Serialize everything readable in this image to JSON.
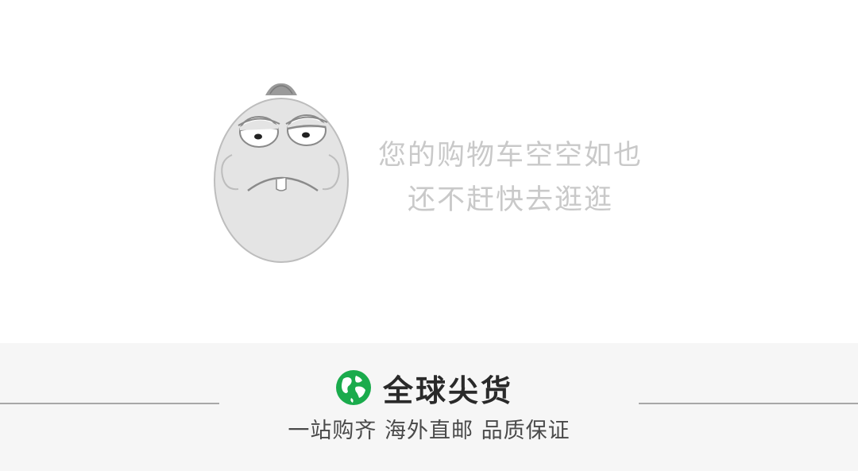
{
  "empty_cart": {
    "line1": "您的购物车空空如也",
    "line2": "还不赶快去逛逛",
    "mascot_icon": "sad-egg-face-icon",
    "text_color": "#c9c9c9"
  },
  "footer": {
    "brand_icon": "green-globe-icon",
    "brand_title": "全球尖货",
    "slogan": "一站购齐 海外直邮 品质保证",
    "brand_color": "#1aab4c"
  }
}
